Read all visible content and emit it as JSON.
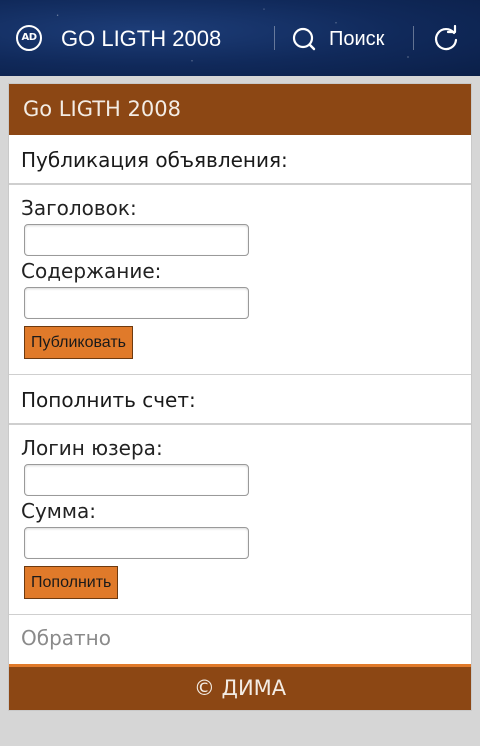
{
  "topbar": {
    "logo_text": "AD",
    "title": "GO LIGTH 2008",
    "search_label": "Поиск",
    "search_icon": "search-icon",
    "refresh_icon": "refresh-icon"
  },
  "page": {
    "header_title": "Go LIGTH 2008",
    "publish_section": {
      "title": "Публикация объявления:",
      "title_label": "Заголовок:",
      "title_value": "",
      "content_label": "Содержание:",
      "content_value": "",
      "submit_label": "Публиковать"
    },
    "topup_section": {
      "title": "Пополнить счет:",
      "login_label": "Логин юзера:",
      "login_value": "",
      "amount_label": "Сумма:",
      "amount_value": "",
      "submit_label": "Пополнить"
    },
    "back_link": "Обратно",
    "footer": "© ДИМА"
  },
  "colors": {
    "header_bg": "#8c4714",
    "button_bg": "#e07a2a",
    "topbar_bg": "#10295a"
  }
}
